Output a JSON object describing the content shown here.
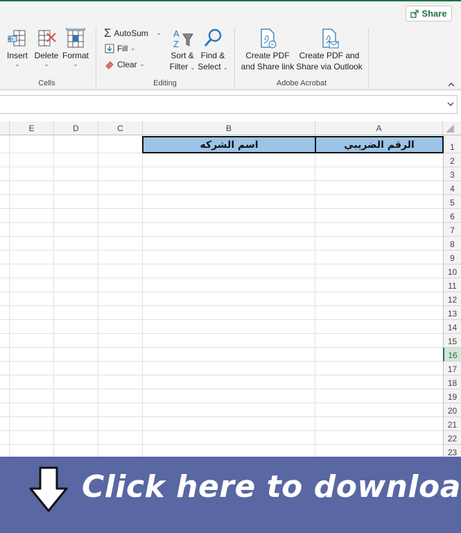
{
  "share": {
    "label": "Share"
  },
  "ribbon": {
    "cells": {
      "group_label": "Cells",
      "insert_label": "Insert",
      "delete_label": "Delete",
      "format_label": "Format"
    },
    "editing": {
      "group_label": "Editing",
      "autosum_label": "AutoSum",
      "fill_label": "Fill",
      "clear_label": "Clear",
      "sort_line1": "Sort &",
      "sort_line2": "Filter",
      "find_line1": "Find &",
      "find_line2": "Select"
    },
    "acrobat": {
      "group_label": "Adobe Acrobat",
      "create_share_line1": "Create PDF",
      "create_share_line2": "and Share link",
      "create_outlook_line1": "Create PDF and",
      "create_outlook_line2": "Share via Outlook"
    }
  },
  "grid": {
    "columns": [
      "E",
      "D",
      "C",
      "B",
      "A"
    ],
    "rows": [
      "1",
      "2",
      "3",
      "4",
      "5",
      "6",
      "7",
      "8",
      "9",
      "10",
      "11",
      "12",
      "13",
      "14",
      "15",
      "16",
      "17",
      "18",
      "19",
      "20",
      "21",
      "22",
      "23"
    ],
    "active_row": "16",
    "cells": {
      "b1": "اسم الشركه",
      "a1": "الرقم الضريبي"
    },
    "header_fill": "#9dc3e6"
  },
  "banner": {
    "text": "Click here to download",
    "background": "#5967a2"
  },
  "colors": {
    "excel_green": "#1e7145"
  }
}
